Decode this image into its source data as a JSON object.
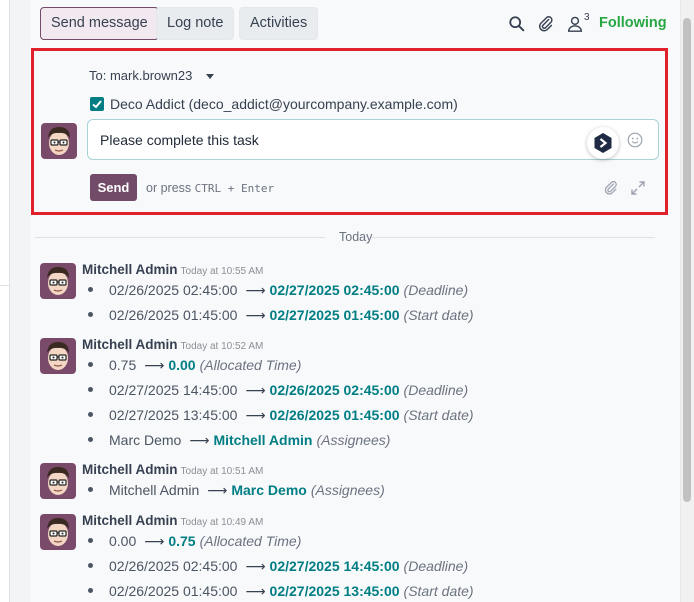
{
  "topbar": {
    "send_message_label": "Send message",
    "log_note_label": "Log note",
    "activities_label": "Activities",
    "follower_count": "3",
    "following_label": "Following"
  },
  "composer": {
    "to_label": "To:",
    "to_value": "mark.brown23",
    "recipient": "Deco Addict (deco_addict@yourcompany.example.com)",
    "message": "Please complete this task",
    "send_label": "Send",
    "press_hint": "or press",
    "shortcut": "CTRL + Enter"
  },
  "separator_label": "Today",
  "messages": [
    {
      "author": "Mitchell Admin",
      "time": "Today at 10:55 AM",
      "changes": [
        {
          "old": "02/26/2025 02:45:00",
          "new": "02/27/2025 02:45:00",
          "field": "(Deadline)"
        },
        {
          "old": "02/26/2025 01:45:00",
          "new": "02/27/2025 01:45:00",
          "field": "(Start date)"
        }
      ]
    },
    {
      "author": "Mitchell Admin",
      "time": "Today at 10:52 AM",
      "changes": [
        {
          "old": "0.75",
          "new": "0.00",
          "field": "(Allocated Time)"
        },
        {
          "old": "02/27/2025 14:45:00",
          "new": "02/26/2025 02:45:00",
          "field": "(Deadline)"
        },
        {
          "old": "02/27/2025 13:45:00",
          "new": "02/26/2025 01:45:00",
          "field": "(Start date)"
        },
        {
          "old": "Marc Demo",
          "new": "Mitchell Admin",
          "field": "(Assignees)"
        }
      ]
    },
    {
      "author": "Mitchell Admin",
      "time": "Today at 10:51 AM",
      "changes": [
        {
          "old": "Mitchell Admin",
          "new": "Marc Demo",
          "field": "(Assignees)"
        }
      ]
    },
    {
      "author": "Mitchell Admin",
      "time": "Today at 10:49 AM",
      "changes": [
        {
          "old": "0.00",
          "new": "0.75",
          "field": "(Allocated Time)"
        },
        {
          "old": "02/26/2025 02:45:00",
          "new": "02/27/2025 14:45:00",
          "field": "(Deadline)"
        },
        {
          "old": "02/26/2025 01:45:00",
          "new": "02/27/2025 13:45:00",
          "field": "(Start date)"
        }
      ]
    }
  ],
  "icons": {
    "search": "search-icon",
    "attach": "paperclip-icon",
    "followers": "user-icon",
    "emoji": "smiley-icon",
    "expand": "expand-icon",
    "ai": "ai-assistant-icon"
  },
  "colors": {
    "accent": "#714b67",
    "teal": "#017e84",
    "following": "#28a745",
    "highlight_border": "#e0202a"
  }
}
